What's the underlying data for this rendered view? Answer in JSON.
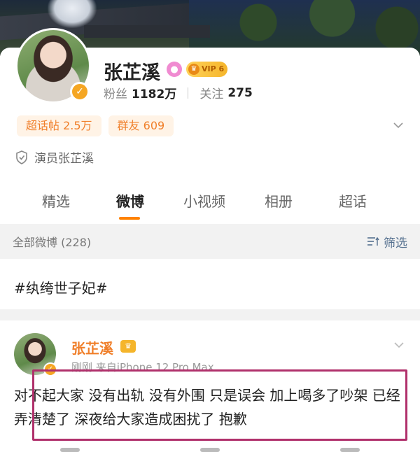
{
  "profile": {
    "name": "张芷溪",
    "vip_label": "VIP 6",
    "followers_label": "粉丝",
    "followers_value": "1182万",
    "following_label": "关注",
    "following_value": "275",
    "chips": [
      {
        "label": "超话帖 2.5万"
      },
      {
        "label": "群友 609"
      }
    ],
    "verification": "演员张芷溪"
  },
  "tabs": [
    {
      "label": "精选"
    },
    {
      "label": "微博"
    },
    {
      "label": "小视频"
    },
    {
      "label": "相册"
    },
    {
      "label": "超话"
    }
  ],
  "active_tab": "微博",
  "filter_bar": {
    "all_posts": "全部微博 (228)",
    "filter_label": "筛选"
  },
  "hashtag": "#纨绔世子妃#",
  "post": {
    "author": "张芷溪",
    "time": "刚刚",
    "source": "来自iPhone 12 Pro Max",
    "text": "对不起大家 没有出轨 没有外围 只是误会 加上喝多了吵架 已经弄清楚了 深夜给大家造成困扰了 抱歉"
  },
  "colors": {
    "accent": "#ff8200",
    "highlight_box": "#b0306b",
    "chip_text": "#f07f2a"
  }
}
